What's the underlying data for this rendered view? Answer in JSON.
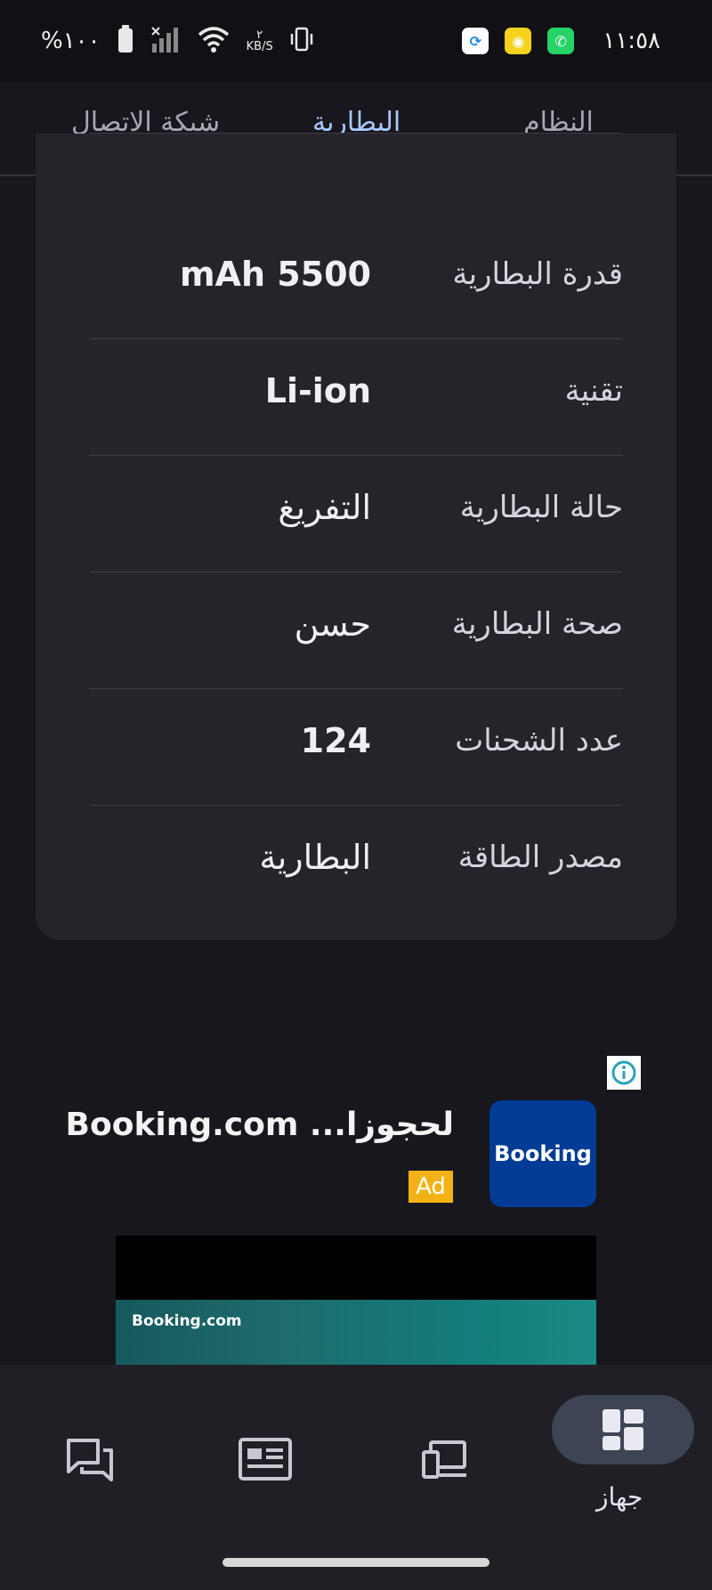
{
  "status_bar": {
    "time": "١١:٥٨",
    "battery_percent": "%١٠٠",
    "net_speed_value": "٢",
    "net_speed_unit": "KB/S",
    "app_icons": [
      "shareit-icon",
      "yellow-app-icon",
      "whatsapp-icon"
    ]
  },
  "tabs": {
    "items": [
      {
        "label": "النظام"
      },
      {
        "label": "البطارية"
      },
      {
        "label": "شبكة الاتصال"
      }
    ],
    "active_index": 1
  },
  "battery_info": {
    "rows": [
      {
        "label": "قدرة البطارية",
        "value": "mAh 5500"
      },
      {
        "label": "تقنية",
        "value": "Li-ion"
      },
      {
        "label": "حالة البطارية",
        "value": "التفريغ"
      },
      {
        "label": "صحة البطارية",
        "value": "حسن"
      },
      {
        "label": "عدد الشحنات",
        "value": "124"
      },
      {
        "label": "مصدر الطاقة",
        "value": "البطارية"
      }
    ]
  },
  "ad": {
    "title": "Booking.com ...لحجوزا",
    "badge": "Ad",
    "logo_text": "Booking",
    "media_brand": "Booking.com"
  },
  "bottom_nav": {
    "items": [
      {
        "icon": "dashboard-icon",
        "label": "جهاز"
      },
      {
        "icon": "devices-icon"
      },
      {
        "icon": "news-icon"
      },
      {
        "icon": "forum-icon"
      }
    ]
  },
  "colors": {
    "accent": "#aac7ff",
    "background": "#18171e",
    "card": "#25242b"
  }
}
